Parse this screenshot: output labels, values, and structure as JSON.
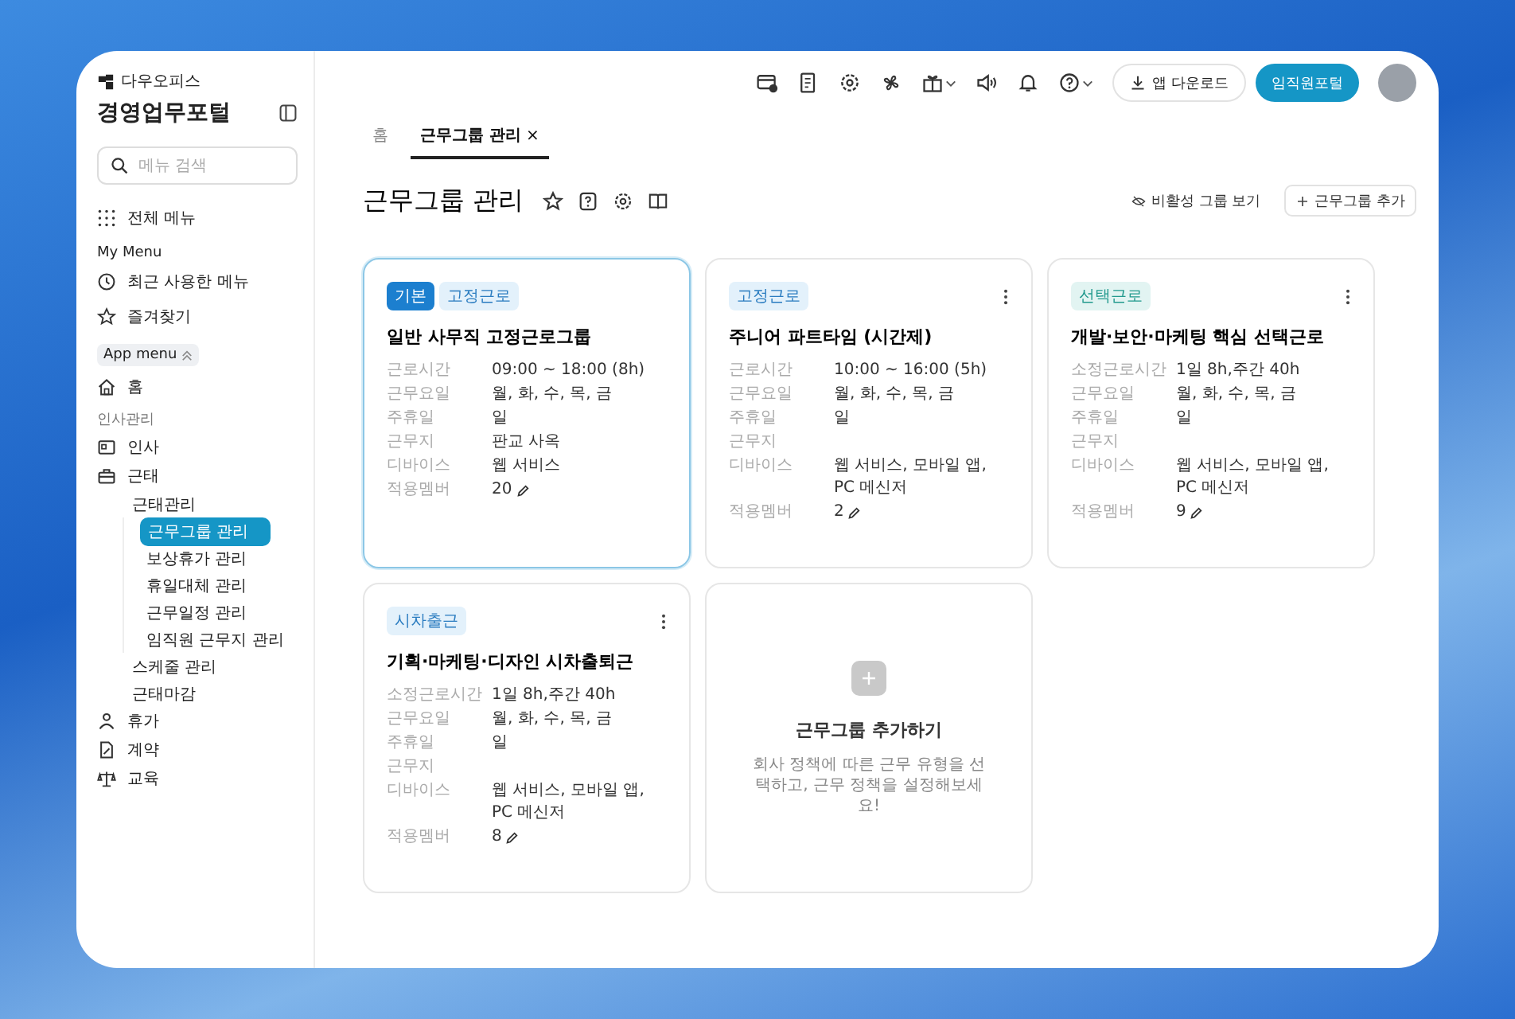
{
  "brand": {
    "name": "다우오피스",
    "title": "경영업무포털"
  },
  "sidebar": {
    "search": {
      "placeholder": "메뉴 검색"
    },
    "all_menu": "전체 메뉴",
    "my_menu": {
      "heading": "My Menu",
      "items": [
        {
          "label": "최근 사용한 메뉴"
        },
        {
          "label": "즐겨찾기"
        }
      ]
    },
    "app_menu": {
      "label": "App menu",
      "expanded": true,
      "home": "홈",
      "section": "인사관리",
      "items": [
        {
          "label": "인사",
          "selected": false
        },
        {
          "label": "근태",
          "selected": false,
          "expanded": true,
          "children": [
            {
              "label": "근태관리",
              "selected": false,
              "expanded": true,
              "children": [
                {
                  "label": "근무그룹 관리",
                  "selected": true
                },
                {
                  "label": "보상휴가 관리",
                  "selected": false
                },
                {
                  "label": "휴일대체 관리",
                  "selected": false
                },
                {
                  "label": "근무일정 관리",
                  "selected": false
                },
                {
                  "label": "임직원 근무지 관리",
                  "selected": false
                }
              ]
            },
            {
              "label": "스케줄 관리",
              "selected": false
            },
            {
              "label": "근태마감",
              "selected": false
            }
          ]
        },
        {
          "label": "휴가",
          "selected": false
        },
        {
          "label": "계약",
          "selected": false
        },
        {
          "label": "교육",
          "selected": false
        }
      ]
    }
  },
  "topbar": {
    "download": "앱 다운로드",
    "portal": "임직원포털"
  },
  "tabs": [
    {
      "label": "홈",
      "selected": false
    },
    {
      "label": "근무그룹 관리",
      "selected": true,
      "close": "×"
    }
  ],
  "page": {
    "title": "근무그룹 관리",
    "inactive_toggle": "비활성 그룹 보기",
    "add_button": "근무그룹 추가"
  },
  "cards": [
    {
      "selected": true,
      "menu": false,
      "badges": [
        {
          "label": "기본",
          "kind": "default"
        },
        {
          "label": "고정근로",
          "kind": "type"
        }
      ],
      "title": "일반 사무직 고정근로그룹",
      "fields": [
        {
          "label": "근로시간",
          "value": "09:00 ~ 18:00 (8h)"
        },
        {
          "label": "근무요일",
          "value": "월, 화, 수, 목, 금"
        },
        {
          "label": "주휴일",
          "value": "일"
        },
        {
          "label": "근무지",
          "value": "판교 사옥"
        },
        {
          "label": "디바이스",
          "value": "웹 서비스"
        }
      ],
      "members": {
        "label": "적용멤버",
        "value": "20"
      }
    },
    {
      "selected": false,
      "menu": true,
      "badges": [
        {
          "label": "고정근로",
          "kind": "type"
        }
      ],
      "title": "주니어 파트타임 (시간제)",
      "fields": [
        {
          "label": "근로시간",
          "value": "10:00 ~ 16:00 (5h)"
        },
        {
          "label": "근무요일",
          "value": "월, 화, 수, 목, 금"
        },
        {
          "label": "주휴일",
          "value": "일"
        },
        {
          "label": "근무지"
        },
        {
          "label": "디바이스",
          "value": "웹 서비스, 모바일 앱, PC 메신저"
        }
      ],
      "members": {
        "label": "적용멤버",
        "value": "2"
      }
    },
    {
      "selected": false,
      "menu": true,
      "badges": [
        {
          "label": "선택근로",
          "kind": "flex"
        }
      ],
      "title": "개발·보안·마케팅 핵심 선택근로",
      "fields": [
        {
          "label": "소정근로시간",
          "value": "1일 8h,주간 40h"
        },
        {
          "label": "근무요일",
          "value": "월, 화, 수, 목, 금"
        },
        {
          "label": "주휴일",
          "value": "일"
        },
        {
          "label": "근무지"
        },
        {
          "label": "디바이스",
          "value": "웹 서비스, 모바일 앱, PC 메신저"
        }
      ],
      "members": {
        "label": "적용멤버",
        "value": "9"
      }
    },
    {
      "selected": false,
      "menu": true,
      "badges": [
        {
          "label": "시차출근",
          "kind": "type"
        }
      ],
      "title": "기획·마케팅·디자인 시차출퇴근",
      "fields": [
        {
          "label": "소정근로시간",
          "value": "1일 8h,주간 40h"
        },
        {
          "label": "근무요일",
          "value": "월, 화, 수, 목, 금"
        },
        {
          "label": "주휴일",
          "value": "일"
        },
        {
          "label": "근무지"
        },
        {
          "label": "디바이스",
          "value": "웹 서비스, 모바일 앱, PC 메신저"
        }
      ],
      "members": {
        "label": "적용멤버",
        "value": "8"
      }
    }
  ],
  "add_card": {
    "title": "근무그룹 추가하기",
    "description": "회사 정책에 따른 근무 유형을 선택하고, 근무 정책을 설정해보세요!"
  }
}
